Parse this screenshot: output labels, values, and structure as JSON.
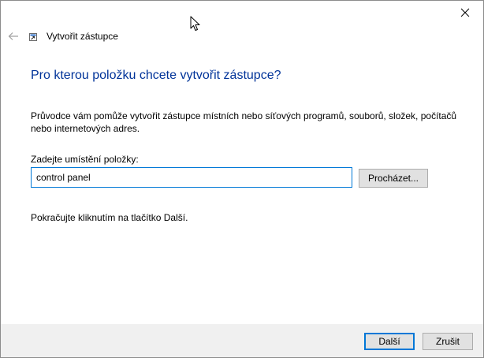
{
  "window": {
    "title": "Vytvořit zástupce"
  },
  "main": {
    "heading": "Pro kterou položku chcete vytvořit zástupce?",
    "description": "Průvodce vám pomůže vytvořit zástupce místních nebo síťových programů, souborů, složek, počítačů nebo internetových adres.",
    "location_label": "Zadejte umístění položky:",
    "location_value": "control panel",
    "browse_label": "Procházet...",
    "hint": "Pokračujte kliknutím na tlačítko Další."
  },
  "footer": {
    "next_label": "Další",
    "cancel_label": "Zrušit"
  },
  "icons": {
    "back": "back-arrow-icon",
    "app": "shortcut-icon",
    "close": "close-icon",
    "cursor": "mouse-pointer-icon"
  },
  "colors": {
    "heading": "#003399",
    "accent": "#0078d7",
    "footer_bg": "#f0f0f0",
    "button_bg": "#e1e1e1"
  }
}
